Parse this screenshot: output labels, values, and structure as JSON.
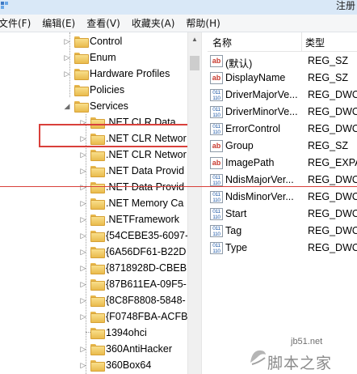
{
  "window": {
    "title_partial": "注册"
  },
  "menu": [
    {
      "label": "文件(F)"
    },
    {
      "label": "编辑(E)"
    },
    {
      "label": "查看(V)"
    },
    {
      "label": "收藏夹(A)"
    },
    {
      "label": "帮助(H)"
    }
  ],
  "tree": {
    "items": [
      {
        "label": "Control",
        "expander": "▷"
      },
      {
        "label": "Enum",
        "expander": "▷"
      },
      {
        "label": "Hardware Profiles",
        "expander": "▷"
      },
      {
        "label": "Policies",
        "expander": ""
      },
      {
        "label": "Services",
        "expander": "◢"
      },
      {
        "label": ".NET CLR Data",
        "expander": "▷"
      },
      {
        "label": ".NET CLR Networ",
        "expander": "▷"
      },
      {
        "label": ".NET CLR Networ",
        "expander": "▷"
      },
      {
        "label": ".NET Data Provid",
        "expander": "▷"
      },
      {
        "label": ".NET Data Provid",
        "expander": "▷"
      },
      {
        "label": ".NET Memory Ca",
        "expander": "▷"
      },
      {
        "label": ".NETFramework",
        "expander": "▷"
      },
      {
        "label": "{54CEBE35-6097-",
        "expander": "▷"
      },
      {
        "label": "{6A56DF61-B22D",
        "expander": "▷"
      },
      {
        "label": "{8718928D-CBEB",
        "expander": "▷"
      },
      {
        "label": "{87B611EA-09F5-",
        "expander": "▷"
      },
      {
        "label": "{8C8F8808-5848-",
        "expander": "▷"
      },
      {
        "label": "{F0748FBA-ACFB-",
        "expander": "▷"
      },
      {
        "label": "1394ohci",
        "expander": ""
      },
      {
        "label": "360AntiHacker",
        "expander": "▷"
      },
      {
        "label": "360Box64",
        "expander": "▷"
      }
    ]
  },
  "values": {
    "header_name": "名称",
    "header_type": "类型",
    "rows": [
      {
        "icon": "ab",
        "name": "(默认)",
        "type": "REG_SZ"
      },
      {
        "icon": "ab",
        "name": "DisplayName",
        "type": "REG_SZ"
      },
      {
        "icon": "bin",
        "name": "DriverMajorVe...",
        "type": "REG_DWO"
      },
      {
        "icon": "bin",
        "name": "DriverMinorVe...",
        "type": "REG_DWO"
      },
      {
        "icon": "bin",
        "name": "ErrorControl",
        "type": "REG_DWO"
      },
      {
        "icon": "ab",
        "name": "Group",
        "type": "REG_SZ"
      },
      {
        "icon": "ab",
        "name": "ImagePath",
        "type": "REG_EXPA"
      },
      {
        "icon": "bin",
        "name": "NdisMajorVer...",
        "type": "REG_DWO"
      },
      {
        "icon": "bin",
        "name": "NdisMinorVer...",
        "type": "REG_DWO"
      },
      {
        "icon": "bin",
        "name": "Start",
        "type": "REG_DWO"
      },
      {
        "icon": "bin",
        "name": "Tag",
        "type": "REG_DWO"
      },
      {
        "icon": "bin",
        "name": "Type",
        "type": "REG_DWO"
      }
    ]
  },
  "icons": {
    "string_value": "ab",
    "binary_value": "011\n110"
  },
  "watermark": {
    "url": "jb51.net",
    "brand": "脚本之家"
  },
  "colors": {
    "highlight": "#d9403b",
    "folder": "#e9bb4d"
  }
}
